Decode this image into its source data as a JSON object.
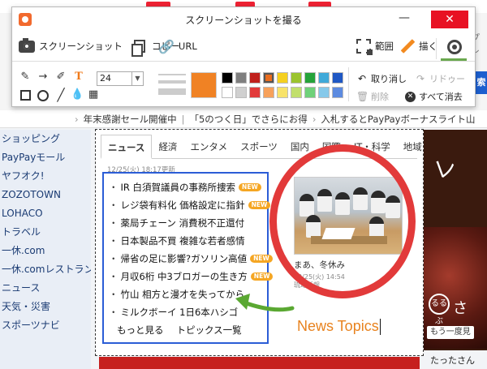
{
  "toolbar": {
    "title": "スクリーンショットを撮る",
    "minimize_glyph": "—",
    "close_glyph": "✕",
    "buttons": {
      "screenshot": "スクリーンショット",
      "copy": "コピー",
      "url": "URL",
      "range": "範囲",
      "draw": "描く"
    },
    "font_size": "24",
    "colors": {
      "current": "#f08224",
      "palette_row1": [
        "#000000",
        "#7f7f7f",
        "#c0201c",
        "#e96d1e",
        "#f5d020",
        "#9bc42e",
        "#25a33a",
        "#3fa9d9",
        "#1f58c4"
      ],
      "palette_row2": [
        "#ffffff",
        "#d0d0d0",
        "#e23a3a",
        "#f7a15b",
        "#f8e36a",
        "#c1df6c",
        "#6fd17a",
        "#86c9ea",
        "#5d8be0"
      ]
    },
    "actions": {
      "undo": "取り消し",
      "redo": "リドゥー",
      "delete": "削除",
      "clear_all": "すべて消去"
    }
  },
  "background": {
    "news_bar": [
      "年末感謝セール開催中",
      "「5のつく日」でさらにお得",
      "入札するとPayPayボーナスライト山"
    ],
    "left_nav": [
      "ショッピング",
      "PayPayモール",
      "ヤフオク!",
      "ZOZOTOWN",
      "LOHACO",
      "トラベル",
      "一休.com",
      "一休.comレストラン",
      "ニュース",
      "天気・災害",
      "スポーツナビ"
    ],
    "ad_seal": "るるぶ",
    "ad_sa": "さ",
    "ad_pill": "もう一度見",
    "ad_bigtext": "レ",
    "right_name": "たったさん",
    "right_edge_text": "プレ",
    "right_btn": "索"
  },
  "capture": {
    "tabs": [
      "ニュース",
      "経済",
      "エンタメ",
      "スポーツ",
      "国内",
      "国際",
      "IT・科学",
      "地域"
    ],
    "timestamp": "12/25(火) 18:17更新",
    "news_items": [
      {
        "text": "IR 白須賀議員の事務所捜索",
        "badge": "NEW"
      },
      {
        "text": "レジ袋有料化 価格設定に指針",
        "badge": "NEW"
      },
      {
        "text": "薬局チェーン 消費税不正還付",
        "badge": ""
      },
      {
        "text": "日本製品不買 複雑な若者感情",
        "badge": ""
      },
      {
        "text": "帰省の足に影響?ガソリン高値",
        "badge": "NEW"
      },
      {
        "text": "月収6桁 中3ブロガーの生き方",
        "badge": "NEW"
      },
      {
        "text": "竹山 相方と漫才を失ってから",
        "badge": ""
      },
      {
        "text": "ミルクボーイ 1日6本ハシゴ",
        "badge": ""
      }
    ],
    "more": "もっと見る",
    "topics_list": "トピックス一覧",
    "photo_caption": "まあ、冬休み",
    "photo_time": "12/25(火) 14:54",
    "photo_source": "琉球新報",
    "annotation_text": "News Topics",
    "annotation_color": "#e8821e",
    "circle_color": "#e23a3a",
    "box_color": "#2b5dd6",
    "arrow_color": "#5aa832"
  }
}
